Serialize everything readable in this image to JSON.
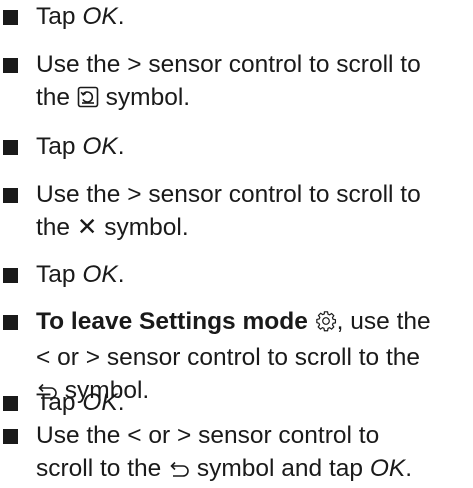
{
  "steps": [
    {
      "tap": "Tap ",
      "ok": "OK",
      "end": "."
    },
    {
      "line1": "Use the ",
      "gt": ">",
      "line1b": " sensor control to scroll to",
      "line2": "the ",
      "icon": "memory-icon",
      "line2b": " symbol."
    },
    {
      "tap": "Tap ",
      "ok": "OK",
      "end": "."
    },
    {
      "line1": "Use the ",
      "gt": ">",
      "line1b": " sensor control to scroll to",
      "line2": "the ",
      "x": "✕",
      "line2b": " symbol."
    },
    {
      "tap": "Tap ",
      "ok": "OK",
      "end": "."
    },
    {
      "bold": "To leave Settings mode",
      "gear": "gear-icon",
      "rest1": ", use the",
      "lt": "<",
      "or": " or ",
      "gt": ">",
      "rest2": " sensor control to scroll to the",
      "back": "back-arrow-icon",
      "rest3": " symbol."
    },
    {
      "tap": "Tap ",
      "ok": "OK",
      "end": "."
    },
    {
      "line1": "Use the ",
      "lt": "<",
      "or": " or ",
      "gt": ">",
      "line1b": " sensor control to",
      "line2": "scroll to the ",
      "back": "back-arrow-icon",
      "line2b": " symbol and tap ",
      "ok": "OK",
      "end": "."
    }
  ]
}
